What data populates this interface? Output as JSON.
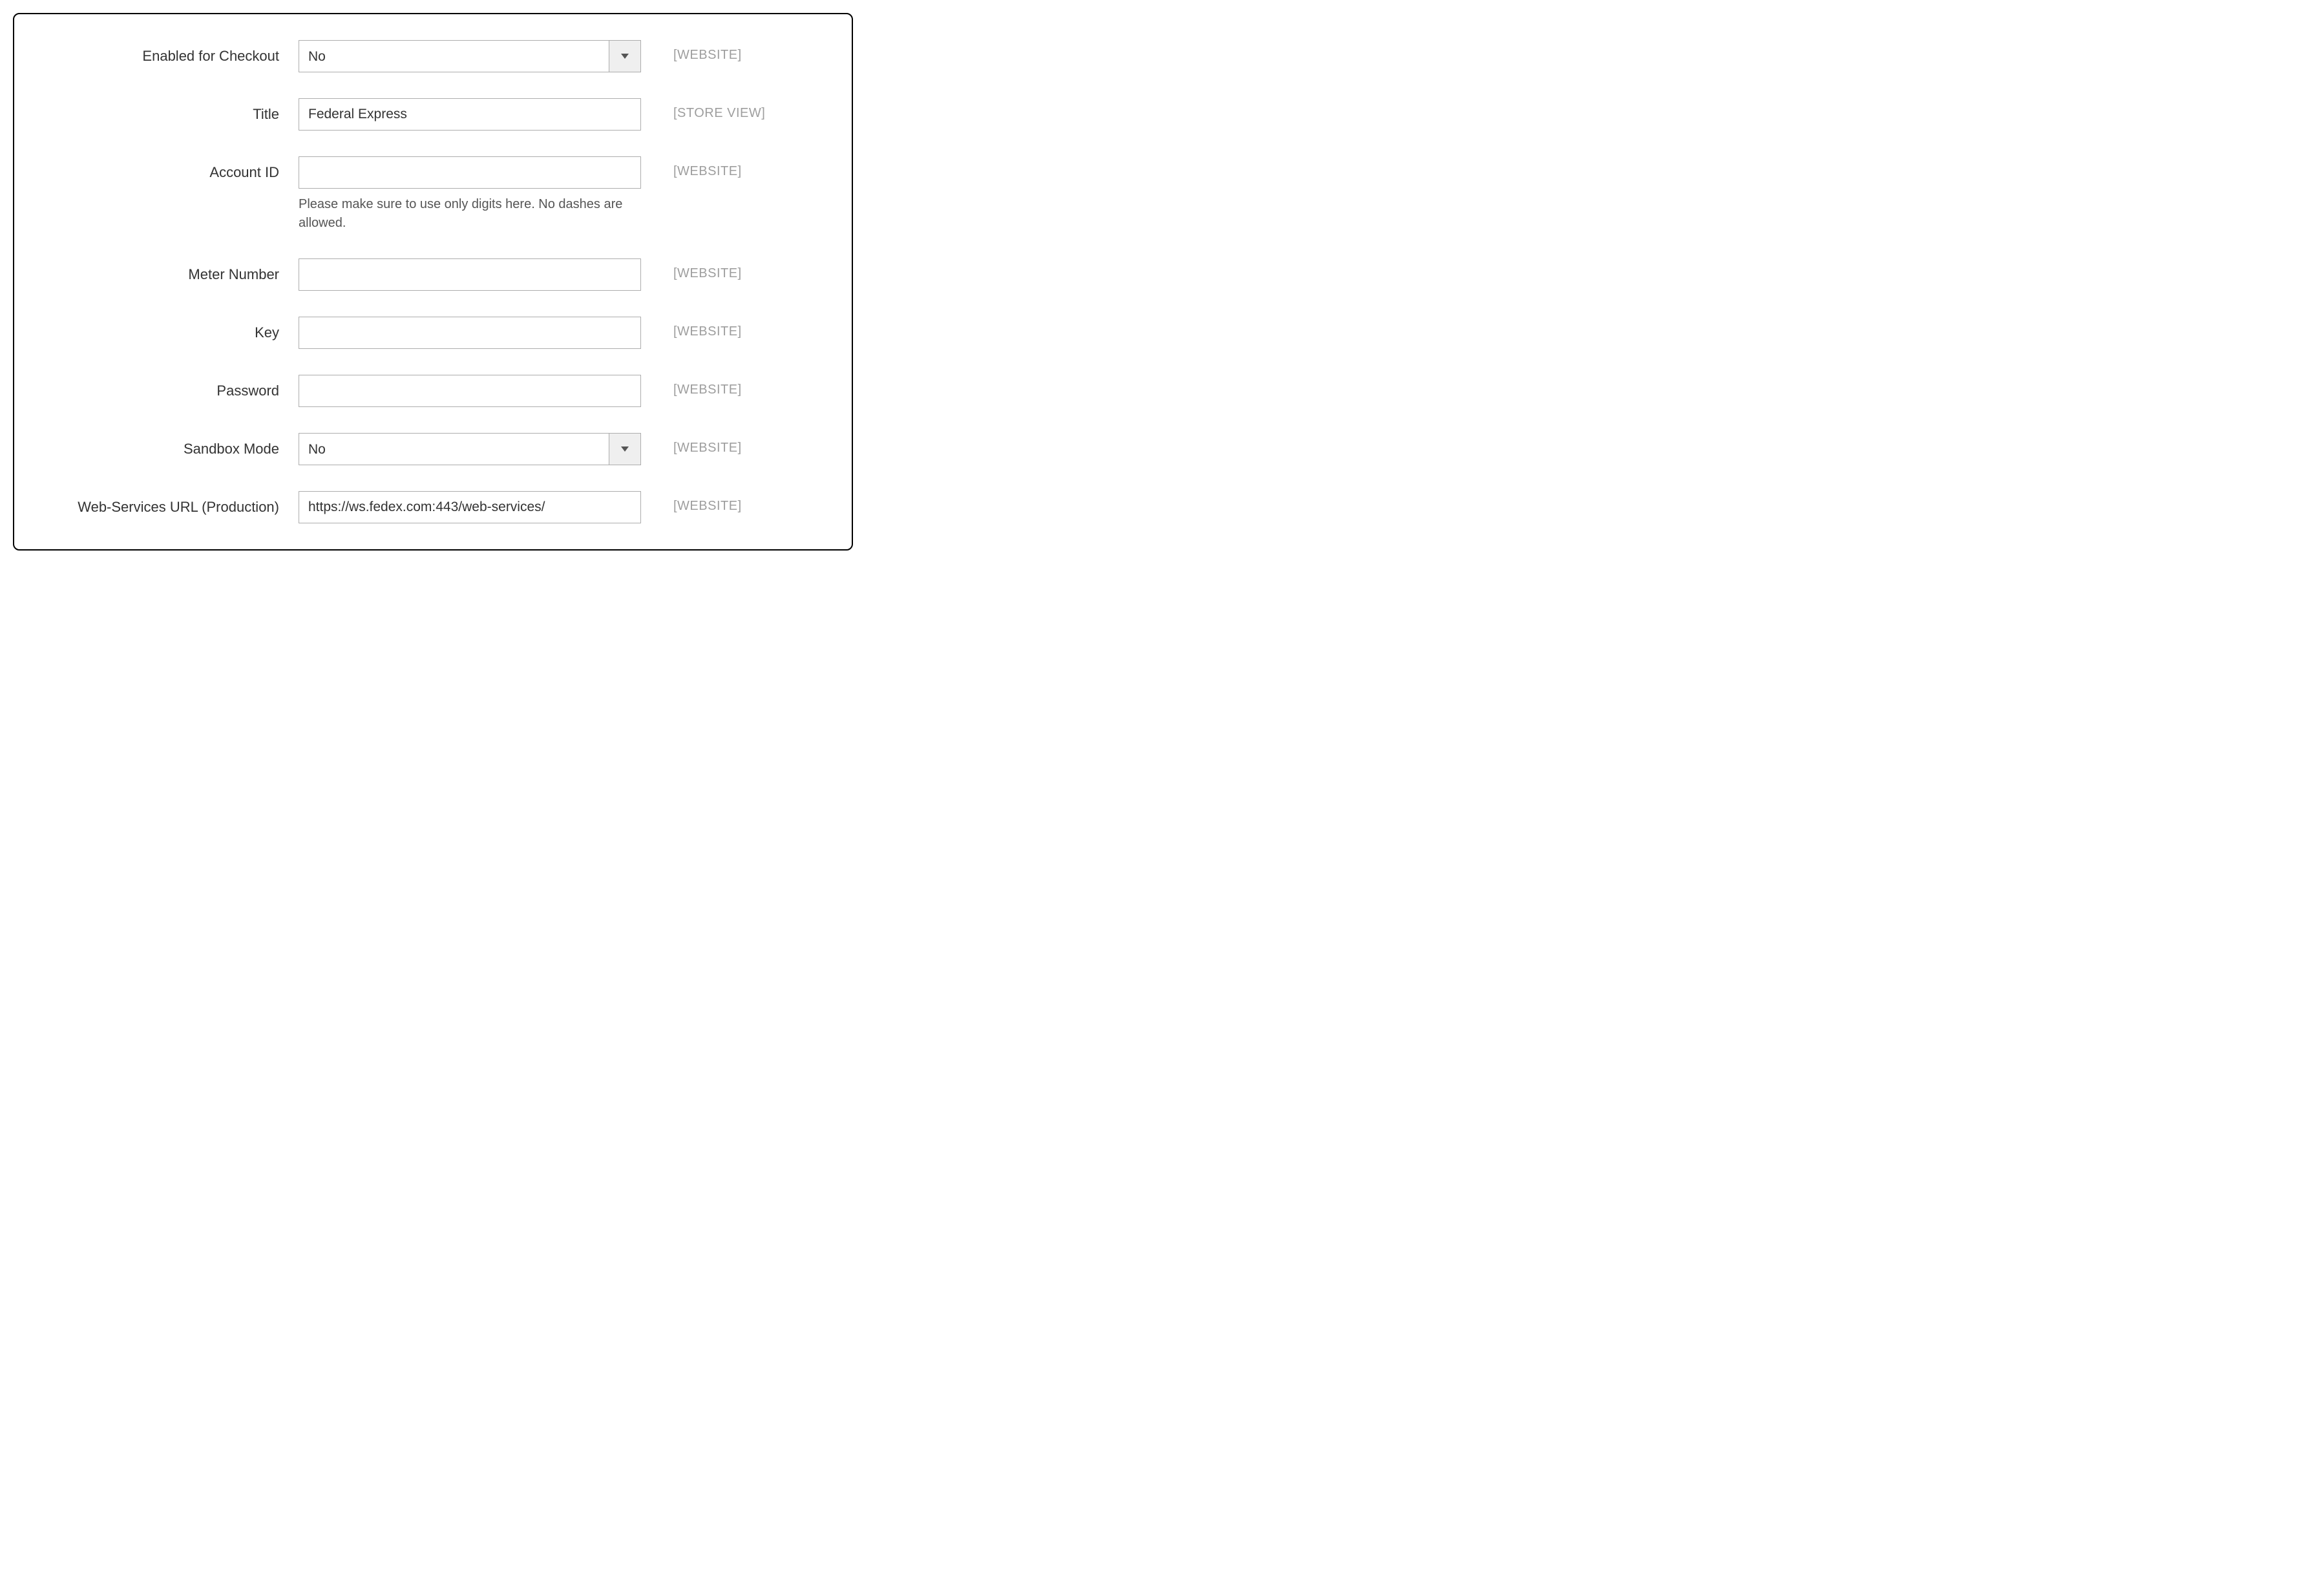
{
  "scopes": {
    "website": "[WEBSITE]",
    "store_view": "[STORE VIEW]"
  },
  "fields": {
    "enabled_for_checkout": {
      "label": "Enabled for Checkout",
      "value": "No"
    },
    "title": {
      "label": "Title",
      "value": "Federal Express"
    },
    "account_id": {
      "label": "Account ID",
      "value": "",
      "help": "Please make sure to use only digits here. No dashes are allowed."
    },
    "meter_number": {
      "label": "Meter Number",
      "value": ""
    },
    "key": {
      "label": "Key",
      "value": ""
    },
    "password": {
      "label": "Password",
      "value": ""
    },
    "sandbox_mode": {
      "label": "Sandbox Mode",
      "value": "No"
    },
    "web_services_url": {
      "label": "Web-Services URL (Production)",
      "value": "https://ws.fedex.com:443/web-services/"
    }
  }
}
